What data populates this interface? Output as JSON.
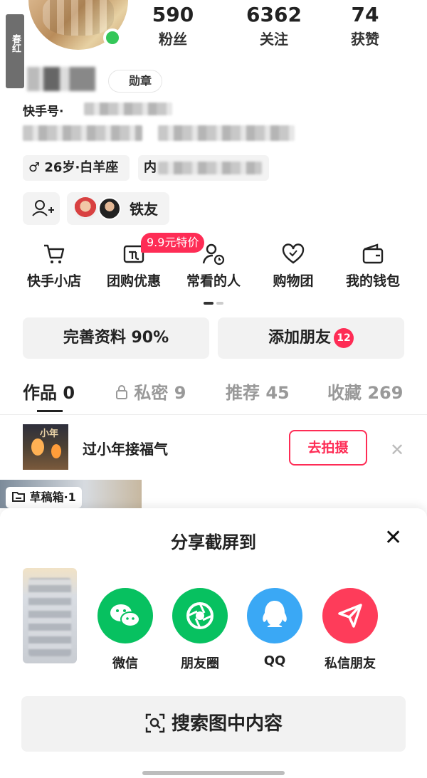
{
  "header": {
    "side_tag": "春红",
    "stats": [
      {
        "num": "590",
        "label": "粉丝"
      },
      {
        "num": "6362",
        "label": "关注"
      },
      {
        "num": "74",
        "label": "获赞"
      }
    ],
    "badge": "勋章",
    "kuaishou_id_label": "快手号·"
  },
  "tags": {
    "age_sign": "♂ 26岁·白羊座",
    "location_prefix": "内",
    "iron_friend": "铁友"
  },
  "quick_menu": {
    "items": [
      {
        "label": "快手小店"
      },
      {
        "label": "团购优惠"
      },
      {
        "label": "常看的人"
      },
      {
        "label": "购物团"
      },
      {
        "label": "我的钱包"
      }
    ],
    "promo": "9.9元特价"
  },
  "actions": {
    "profile": "完善资料 90%",
    "add_friend": "添加朋友",
    "add_friend_count": "12"
  },
  "tabs": [
    {
      "label": "作品 0"
    },
    {
      "label": "私密 9"
    },
    {
      "label": "推荐 45"
    },
    {
      "label": "收藏 269"
    }
  ],
  "banner": {
    "thumb_text": "小年",
    "text": "过小年接福气",
    "button": "去拍摄"
  },
  "draft": {
    "label": "草稿箱·1"
  },
  "share_sheet": {
    "title": "分享截屏到",
    "targets": [
      {
        "label": "微信",
        "color": "#07c160"
      },
      {
        "label": "朋友圈",
        "color": "#07c160"
      },
      {
        "label": "QQ",
        "color": "#3aa8f5"
      },
      {
        "label": "私信朋友",
        "color": "#fe3c5a"
      }
    ],
    "search_label": "搜索图中内容"
  },
  "colors": {
    "accent": "#fe2c55",
    "online": "#34c759"
  }
}
